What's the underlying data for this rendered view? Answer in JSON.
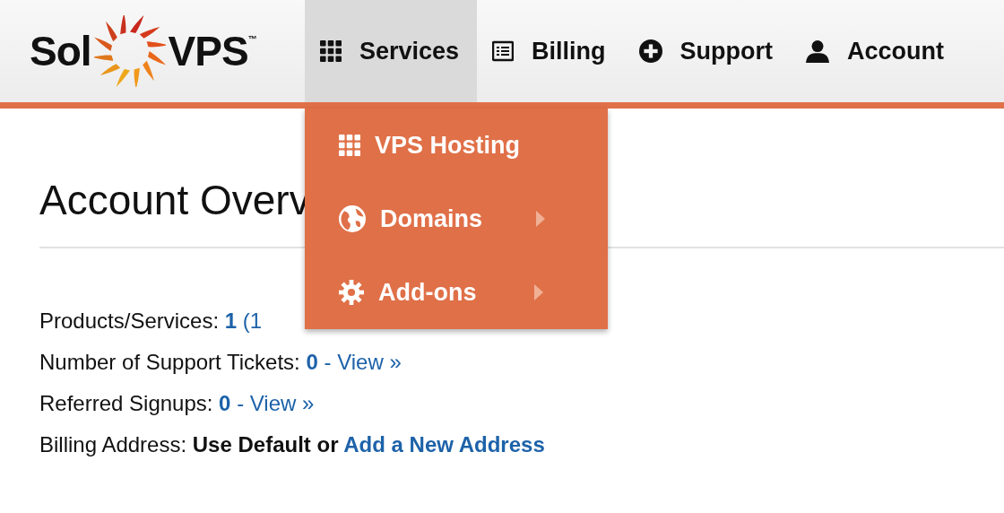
{
  "logo": {
    "left": "Sol",
    "right": "VPS",
    "mark": "™"
  },
  "nav": [
    {
      "label": "Services",
      "kind": "grid",
      "selected": true
    },
    {
      "label": "Billing",
      "kind": "list",
      "selected": false
    },
    {
      "label": "Support",
      "kind": "plus",
      "selected": false
    },
    {
      "label": "Account",
      "kind": "person",
      "selected": false
    }
  ],
  "dropdown": [
    {
      "label": "VPS Hosting",
      "kind": "grid",
      "submenu": false
    },
    {
      "label": "Domains",
      "kind": "globe",
      "submenu": true
    },
    {
      "label": "Add-ons",
      "kind": "gear",
      "submenu": true
    }
  ],
  "title": "Account Overv",
  "rows": [
    [
      {
        "kind": "plain",
        "text": "Products/Services: "
      },
      {
        "kind": "link-bold",
        "text": "1"
      },
      {
        "kind": "link",
        "text": " (1"
      }
    ],
    [
      {
        "kind": "plain",
        "text": "Number of Support Tickets: "
      },
      {
        "kind": "link-bold",
        "text": "0"
      },
      {
        "kind": "link",
        "text": " - View »"
      }
    ],
    [
      {
        "kind": "plain",
        "text": "Referred Signups: "
      },
      {
        "kind": "link-bold",
        "text": "0"
      },
      {
        "kind": "link",
        "text": " - View »"
      }
    ],
    [
      {
        "kind": "plain",
        "text": "Billing Address: "
      },
      {
        "kind": "bold",
        "text": "Use Default or "
      },
      {
        "kind": "link-bold",
        "text": "Add a New Address"
      }
    ]
  ]
}
